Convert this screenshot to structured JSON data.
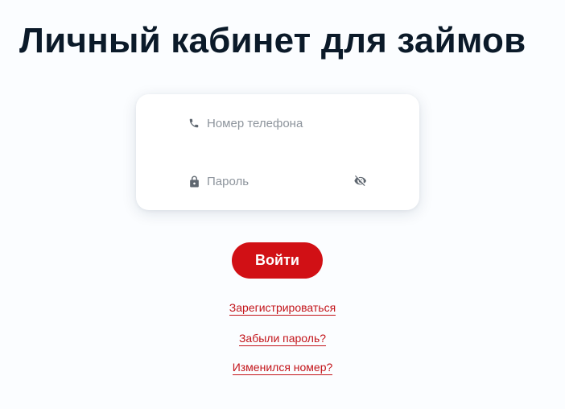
{
  "page": {
    "title": "Личный кабинет для займов"
  },
  "form": {
    "phone_placeholder": "Номер телефона",
    "phone_value": "",
    "password_placeholder": "Пароль",
    "password_value": "",
    "login_label": "Войти"
  },
  "links": {
    "register": "Зарегистрироваться",
    "forgot_password": "Забыли пароль?",
    "number_changed": "Изменился номер?"
  },
  "icons": {
    "phone": "phone-icon",
    "lock": "lock-icon",
    "visibility": "eye-off-icon"
  },
  "colors": {
    "accent": "#d11015",
    "link": "#c3141a",
    "title": "#0b1a29",
    "background": "#fbfdff"
  }
}
